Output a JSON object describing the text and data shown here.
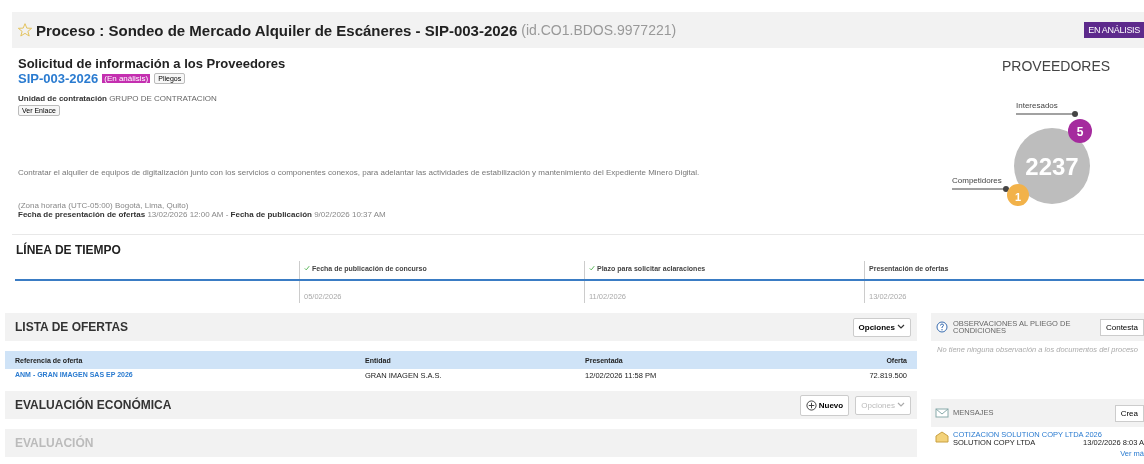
{
  "header": {
    "title": "Proceso : Sondeo de Mercado Alquiler de Escáneres - SIP-003-2026",
    "id": "(id.CO1.BDOS.9977221)",
    "status": "EN ANÁLISIS"
  },
  "info": {
    "heading": "Solicitud de información a los Proveedores",
    "code": "SIP-003-2026",
    "status": "(En análisis)",
    "pliegos_button": "Pliegos",
    "unit_label": "Unidad de contratación",
    "unit_value": "GRUPO DE CONTRATACION",
    "link_button": "Ver Enlace",
    "description": "Contratar el alquiler de equipos de digitalización junto con los servicios o componentes conexos, para adelantar las actividades de estabilización y mantenimiento del Expediente Minero Digital.",
    "timezone": "(Zona horaria (UTC-05:00) Bogotá, Lima, Quito)",
    "dates": "**Fecha de presentación de ofertas** 13/02/2026 12:00 AM - **Fecha de publicación** 9/02/2026 10:37 AM"
  },
  "providers": {
    "title": "PROVEEDORES",
    "total": "2237",
    "interested_label": "Interesados",
    "interested": "5",
    "competitors_label": "Competidores",
    "competitors": "1"
  },
  "timeline": {
    "title": "LÍNEA DE TIEMPO",
    "items": [
      {
        "label": "Fecha de publicación de concurso",
        "date": "05/02/2026",
        "done": true
      },
      {
        "label": "Plazo para solicitar aclaraciones",
        "date": "11/02/2026",
        "done": true
      },
      {
        "label": "Presentación de ofertas",
        "date": "13/02/2026",
        "done": false
      }
    ]
  },
  "offers": {
    "title": "LISTA DE OFERTAS",
    "options": "Opciones",
    "columns": [
      "Referencia de oferta",
      "Entidad",
      "Presentada",
      "Oferta"
    ],
    "rows": [
      {
        "reference": "ANM - GRAN IMAGEN SAS EP 2026",
        "entity": "GRAN IMAGEN S.A.S.",
        "submitted": "12/02/2026 11:58 PM",
        "amount": "72.819.500"
      }
    ]
  },
  "economic": {
    "title": "EVALUACIÓN ECONÓMICA",
    "new_button": "Nuevo",
    "options": "Opciones",
    "options_disabled": true
  },
  "evaluation": {
    "title": "EVALUACIÓN"
  },
  "observations": {
    "title": "OBSERVACIONES AL PLIEGO DE CONDICIONES",
    "button": "Contesta",
    "empty": "No tiene ninguna observación a los documentos del proceso"
  },
  "messages": {
    "title": "MENSAJES",
    "button": "Crea",
    "items": [
      {
        "subject": "COTIZACION SOLUTION COPY LTDA 2026",
        "sender": "SOLUTION COPY LTDA",
        "date": "13/02/2026 8:03 A"
      }
    ],
    "more": "Ver má"
  }
}
